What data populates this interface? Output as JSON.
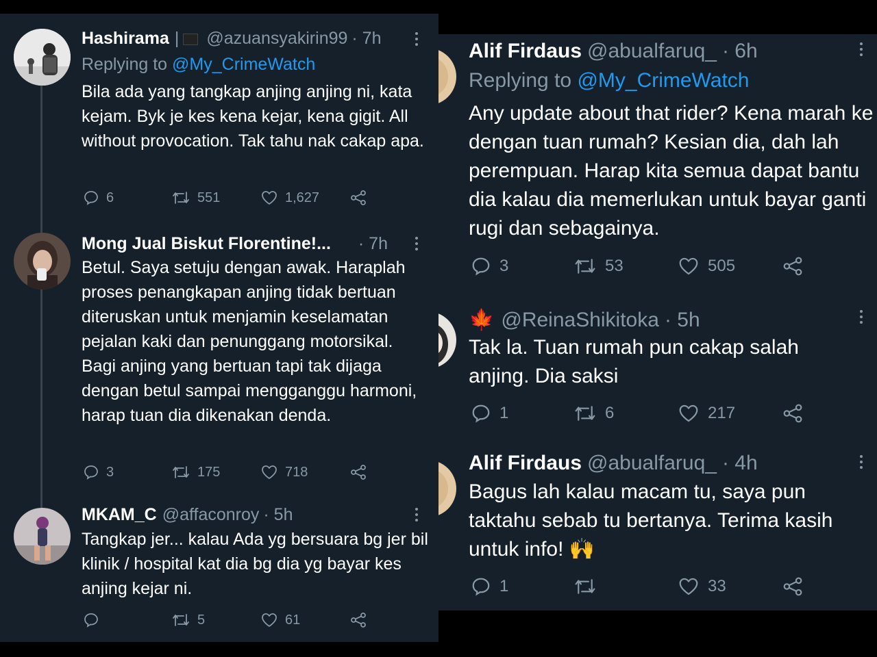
{
  "left_thread": [
    {
      "name": "Hashirama",
      "name_suffix": "|",
      "handle": "@azuansyakirin99",
      "time": "· 7h",
      "reply_prefix": "Replying to",
      "reply_handle": "@My_CrimeWatch",
      "text": "Bila ada yang tangkap anjing anjing ni, kata kejam. Byk je kes kena kejar, kena gigit. All without provocation. Tak tahu nak cakap apa.",
      "replies": "6",
      "retweets": "551",
      "likes": "1,627"
    },
    {
      "name": "Mong Jual Biskut Florentine!...",
      "handle": "",
      "time": "· 7h",
      "text": "Betul. Saya setuju dengan awak. Haraplah proses penangkapan anjing tidak bertuan diteruskan untuk menjamin keselamatan pejalan kaki dan penunggang motorsikal. Bagi anjing yang bertuan tapi tak dijaga dengan betul sampai mengganggu harmoni, harap tuan dia dikenakan denda.",
      "replies": "3",
      "retweets": "175",
      "likes": "718"
    },
    {
      "name": "MKAM_C",
      "handle": "@affaconroy",
      "time": "· 5h",
      "text": "Tangkap jer... kalau Ada yg bersuara bg jer bil klinik / hospital kat dia bg dia yg bayar kes anjing kejar ni.",
      "replies": "",
      "retweets": "5",
      "likes": "61"
    }
  ],
  "right_thread": [
    {
      "name": "Alif Firdaus",
      "handle": "@abualfaruq_",
      "time": "· 6h",
      "reply_prefix": "Replying to",
      "reply_handle": "@My_CrimeWatch",
      "text": "Any update about that rider? Kena marah ke dengan tuan rumah? Kesian dia, dah lah perempuan. Harap kita semua dapat bantu dia kalau dia memerlukan untuk bayar ganti rugi dan sebagainya.",
      "replies": "3",
      "retweets": "53",
      "likes": "505"
    },
    {
      "name": "🍁",
      "handle": "@ReinaShikitoka",
      "time": "· 5h",
      "text": "Tak la. Tuan rumah pun cakap salah anjing. Dia saksi",
      "replies": "1",
      "retweets": "6",
      "likes": "217"
    },
    {
      "name": "Alif Firdaus",
      "handle": "@abualfaruq_",
      "time": "· 4h",
      "text": "Bagus lah kalau macam tu, saya pun taktahu sebab tu bertanya. Terima kasih untuk info! 🙌",
      "replies": "1",
      "retweets": "",
      "likes": "33"
    }
  ],
  "colors": {
    "background": "#15202b",
    "outer_background": "#000000",
    "text_primary": "#ffffff",
    "text_secondary": "#8899a6",
    "link": "#1d9bf0",
    "thread_line": "#38444d"
  },
  "icons": [
    "reply-icon",
    "retweet-icon",
    "like-icon",
    "share-icon",
    "more-icon"
  ]
}
